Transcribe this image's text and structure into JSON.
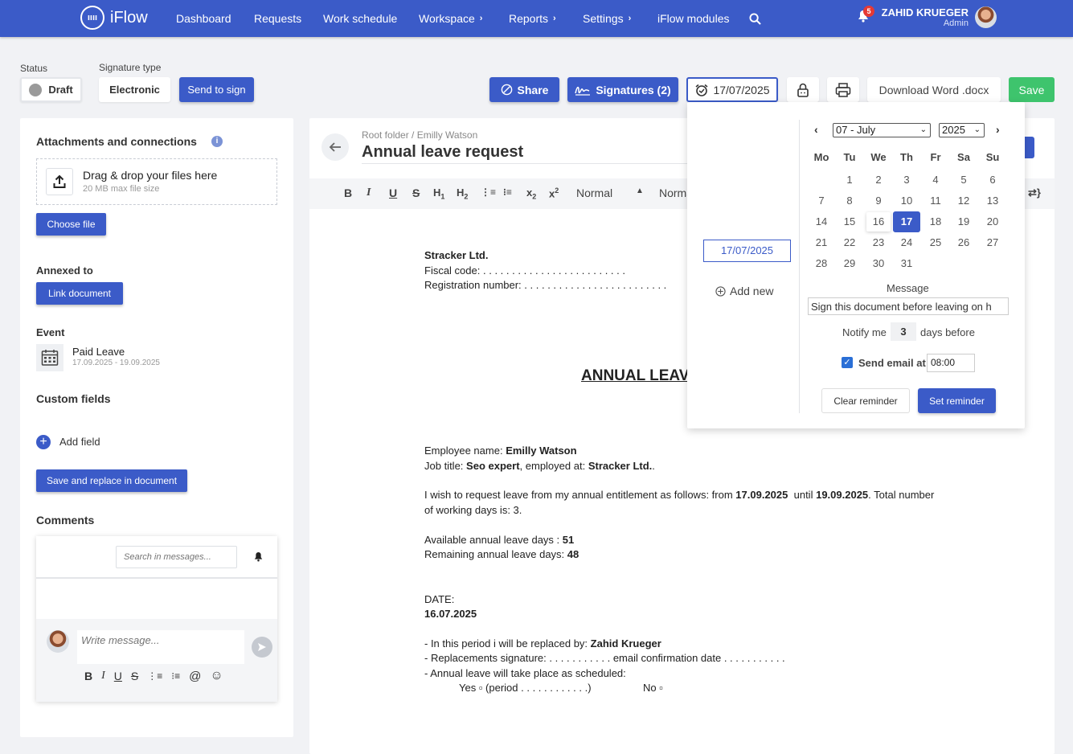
{
  "app": {
    "name": "iFlow"
  },
  "nav": {
    "items": [
      "Dashboard",
      "Requests",
      "Work schedule",
      "Workspace",
      "Reports",
      "Settings",
      "iFlow modules"
    ]
  },
  "notifications": {
    "count": "5"
  },
  "user": {
    "name": "ZAHID KRUEGER",
    "role": "Admin"
  },
  "status": {
    "label": "Status",
    "value": "Draft"
  },
  "signature_type": {
    "label": "Signature type",
    "value": "Electronic",
    "send_label": "Send to sign"
  },
  "actions": {
    "share": "Share",
    "signatures": "Signatures (2)",
    "reminder_date": "17/07/2025",
    "download": "Download Word .docx",
    "save": "Save"
  },
  "left": {
    "attachments_title": "Attachments and connections",
    "drop_text": "Drag & drop your files here",
    "max_size": "20 MB max file size",
    "choose_file": "Choose file",
    "annexed_title": "Annexed to",
    "link_document": "Link document",
    "event_title": "Event",
    "event_name": "Paid Leave",
    "event_dates": "17.09.2025 - 19.09.2025",
    "custom_fields_title": "Custom fields",
    "add_field": "Add field",
    "save_replace": "Save and replace in document",
    "comments_title": "Comments",
    "search_placeholder": "Search in messages...",
    "write_placeholder": "Write message..."
  },
  "document": {
    "breadcrumb": "Root folder / Emilly Watson",
    "title": "Annual leave request",
    "style_select_1": "Normal",
    "style_select_2": "Norma",
    "company": "Stracker Ltd.",
    "fiscal_label": "Fiscal code:",
    "fiscal_dots": ". . . . . . . . . . . . . . . . . . . . . . . . .",
    "reg_label": "Registration number:",
    "reg_dots": ". . . . . . . . . . . . . . . . . . . . . . . . .",
    "heading": "ANNUAL LEAV",
    "emp_label": "Employee name:",
    "emp_name": "Emilly Watson",
    "job_label": "Job title:",
    "job_value": "Seo expert",
    "employed_label": ", employed at:",
    "employer": "Stracker Ltd.",
    "employer_tail": ".",
    "leave_text_1": "I wish to request leave from my annual entitlement as follows: from",
    "leave_from": "17.09.2025",
    "leave_until_label": "until",
    "leave_until": "19.09.2025",
    "leave_text_2": ". Total number",
    "working_days_text": "of working days is: 3.",
    "available_label": "Available annual leave days :",
    "available_value": "51",
    "remaining_label": "Remaining annual leave days:",
    "remaining_value": "48",
    "date_label": "DATE:",
    "date_value": "16.07.2025",
    "replaced_label": "- In this period i will be replaced by:",
    "replaced_name": "Zahid Krueger",
    "replacement_sig": "- Replacements signature: . . . . . . . . . . .  email confirmation date . . . . . . . . . . .",
    "scheduled": "- Annual leave will take place as scheduled:",
    "yes_text": "Yes ▫ (period . . . . . . . . . . . .)",
    "no_text": "No ▫"
  },
  "reminder": {
    "date_value": "17/07/2025",
    "add_new": "Add new",
    "month": "07 - July",
    "year": "2025",
    "weekdays": [
      "Mo",
      "Tu",
      "We",
      "Th",
      "Fr",
      "Sa",
      "Su"
    ],
    "days": [
      "1",
      "2",
      "3",
      "4",
      "5",
      "6",
      "7",
      "8",
      "9",
      "10",
      "11",
      "12",
      "13",
      "14",
      "15",
      "16",
      "17",
      "18",
      "19",
      "20",
      "21",
      "22",
      "23",
      "24",
      "25",
      "26",
      "27",
      "28",
      "29",
      "30",
      "31"
    ],
    "selected_day": "17",
    "today_day": "16",
    "message_label": "Message",
    "message_value": "Sign this document before leaving on h",
    "notify_label": "Notify me",
    "notify_value": "3",
    "days_before": "days before",
    "email_label": "Send email at",
    "email_time": "08:00",
    "email_checked": true,
    "clear": "Clear reminder",
    "set": "Set reminder"
  },
  "colors": {
    "primary": "#3b5bc8",
    "success": "#3ec46d",
    "badge": "#e53935"
  }
}
